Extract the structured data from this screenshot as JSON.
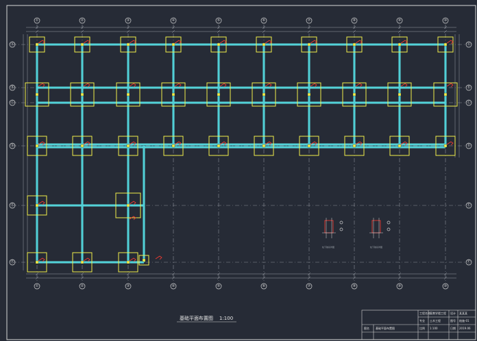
{
  "drawing": {
    "title": "基础平面布置图",
    "scale": "1:100"
  },
  "axes": {
    "columns": [
      "①",
      "②",
      "③",
      "④",
      "⑤",
      "⑥",
      "⑦",
      "⑧",
      "⑨",
      "⑩"
    ],
    "rows": [
      "Ⓐ",
      "Ⓑ",
      "Ⓒ",
      "Ⓓ",
      "Ⓔ",
      "Ⓕ",
      "Ⓖ"
    ]
  },
  "details": [
    {
      "label": "柱下独基详图"
    },
    {
      "label": "柱下独基详图"
    }
  ],
  "title_block": {
    "cells": [
      {
        "label": "工程名称",
        "value": "某教学楼工程"
      },
      {
        "label": "设计",
        "value": "某某某"
      },
      {
        "label": "图号",
        "value": "结施-01"
      },
      {
        "label": "专业",
        "value": "土木工程"
      },
      {
        "label": "比例",
        "value": "1:100"
      },
      {
        "label": "日期",
        "value": "2019.06"
      },
      {
        "label": "图名",
        "value": "基础平面布置图"
      }
    ]
  },
  "colors": {
    "background": "#262b36",
    "footing": "#f2ef4a",
    "beam": "#5fe0e6",
    "tag": "#ff3b30"
  }
}
